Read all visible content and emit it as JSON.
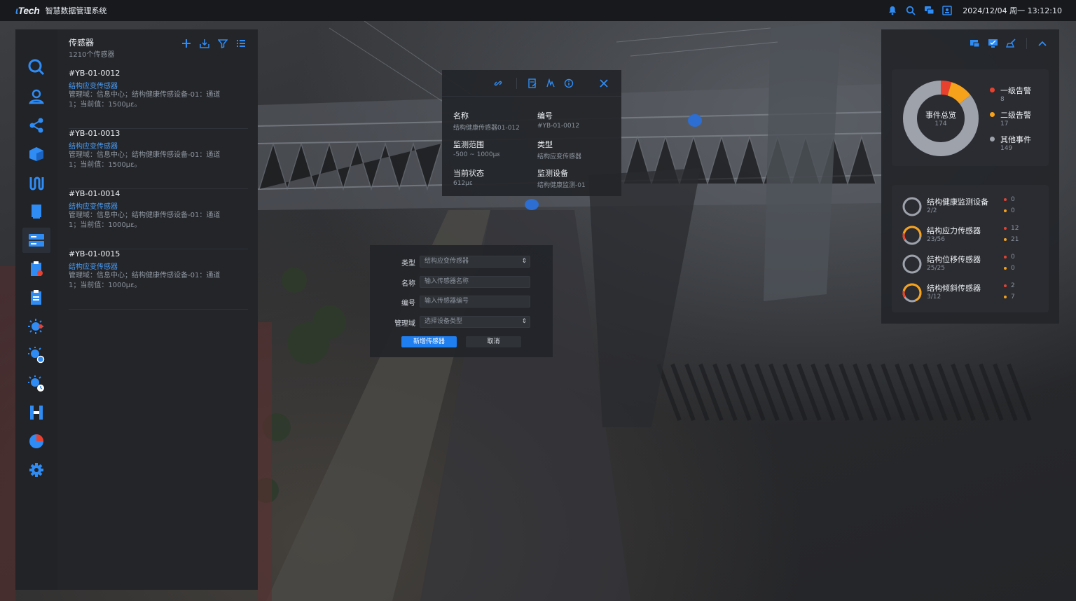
{
  "app": {
    "logo_text": "Tech",
    "title": "智慧数据管理系统",
    "datetime": "2024/12/04 周一 13:12:10"
  },
  "top_icons": [
    "bell-icon",
    "search-icon",
    "chat-icon",
    "user-card-icon"
  ],
  "rail": {
    "items": [
      "search-icon",
      "user-location-icon",
      "share-icon",
      "cube-icon",
      "pipeline-icon",
      "document-icon",
      "server-icon",
      "report-icon",
      "clipboard-icon",
      "sun-alert-icon",
      "sun-refresh-icon",
      "sun-clock-icon",
      "bridge-icon",
      "pie-chart-icon",
      "gear-icon"
    ],
    "active_index": 6
  },
  "sensor_panel": {
    "title": "传感器",
    "count": "1210个传感器",
    "tools": [
      "plus-icon",
      "import-icon",
      "filter-icon",
      "list-icon"
    ],
    "items": [
      {
        "id": "#YB-01-0012",
        "type": "结构应变传感器",
        "desc": "管理域：信息中心；结构健康传感设备-01：通道1；当前值：1500με。"
      },
      {
        "id": "#YB-01-0013",
        "type": "结构应变传感器",
        "desc": "管理域：信息中心；结构健康传感设备-01：通道1；当前值：1500με。"
      },
      {
        "id": "#YB-01-0014",
        "type": "结构应变传感器",
        "desc": "管理域：信息中心；结构健康传感设备-01：通道1；当前值：1000με。"
      },
      {
        "id": "#YB-01-0015",
        "type": "结构应变传感器",
        "desc": "管理域：信息中心；结构健康传感设备-01：通道1；当前值：1000με。"
      }
    ]
  },
  "detail_popup": {
    "tools": [
      "link-icon",
      "doc-edit-icon",
      "signature-icon",
      "info-icon",
      "close-icon"
    ],
    "fields": [
      {
        "label": "名称",
        "value": "结构健康传感器01-012"
      },
      {
        "label": "编号",
        "value": "#YB-01-0012"
      },
      {
        "label": "监测范围",
        "value": "-500 ~ 1000με"
      },
      {
        "label": "类型",
        "value": "结构应变传感器"
      },
      {
        "label": "当前状态",
        "value": "612με"
      },
      {
        "label": "监测设备",
        "value": "结构健康监测-01"
      }
    ]
  },
  "add_form": {
    "rows": [
      {
        "label": "类型",
        "value": "结构应变传感器",
        "select": true
      },
      {
        "label": "名称",
        "value": "输入传感器名称",
        "select": false
      },
      {
        "label": "编号",
        "value": "输入传感器编号",
        "select": false
      },
      {
        "label": "管理域",
        "value": "选择设备类型",
        "select": true
      }
    ],
    "submit_label": "新增传感器",
    "cancel_label": "取消"
  },
  "right_panel": {
    "tools": [
      "screen-share-icon",
      "monitor-icon",
      "broom-icon",
      "chevron-up-icon"
    ],
    "events": {
      "center_title": "事件总览",
      "total": "174",
      "legend": [
        {
          "label": "一级告警",
          "value": "8",
          "color": "#e8412f"
        },
        {
          "label": "二级告警",
          "value": "17",
          "color": "#f7a21b"
        },
        {
          "label": "其他事件",
          "value": "149",
          "color": "#9ea2ab"
        }
      ]
    },
    "devices": [
      {
        "name": "结构健康监测设备",
        "count": "2/2",
        "red": "0",
        "orange": "0",
        "ring_fraction": 0
      },
      {
        "name": "结构应力传感器",
        "count": "23/56",
        "red": "12",
        "orange": "21",
        "ring_fraction": 0.6
      },
      {
        "name": "结构位移传感器",
        "count": "25/25",
        "red": "0",
        "orange": "0",
        "ring_fraction": 0
      },
      {
        "name": "结构倾斜传感器",
        "count": "3/12",
        "red": "2",
        "orange": "7",
        "ring_fraction": 0.75
      }
    ]
  },
  "colors": {
    "accent": "#1f7ef0",
    "link": "#4a9cf5",
    "alert_red": "#e8412f",
    "alert_orange": "#f7a21b",
    "muted": "#9ea2ab"
  }
}
